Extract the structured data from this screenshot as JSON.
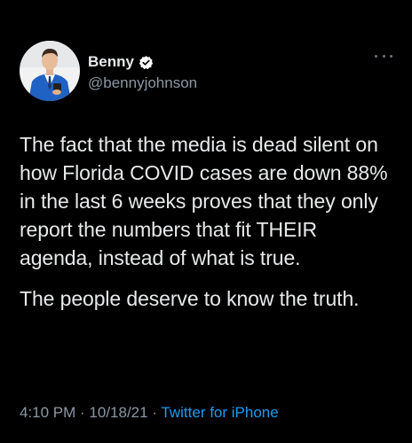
{
  "author": {
    "display_name": "Benny",
    "handle": "@bennyjohnson",
    "verified": true,
    "avatar_icon": "profile-photo"
  },
  "tweet": {
    "paragraphs": [
      "The fact that the media is dead silent on how Florida COVID cases are down 88% in the last 6 weeks proves that they only report the numbers that fit THEIR agenda, instead of what is true.",
      "The people deserve to know the truth."
    ],
    "time": "4:10 PM",
    "separator": " · ",
    "date": "10/18/21",
    "source": "Twitter for iPhone"
  },
  "colors": {
    "background": "#000000",
    "text": "#e7e9ea",
    "muted": "#8b98a5",
    "link": "#1d9bf0"
  }
}
